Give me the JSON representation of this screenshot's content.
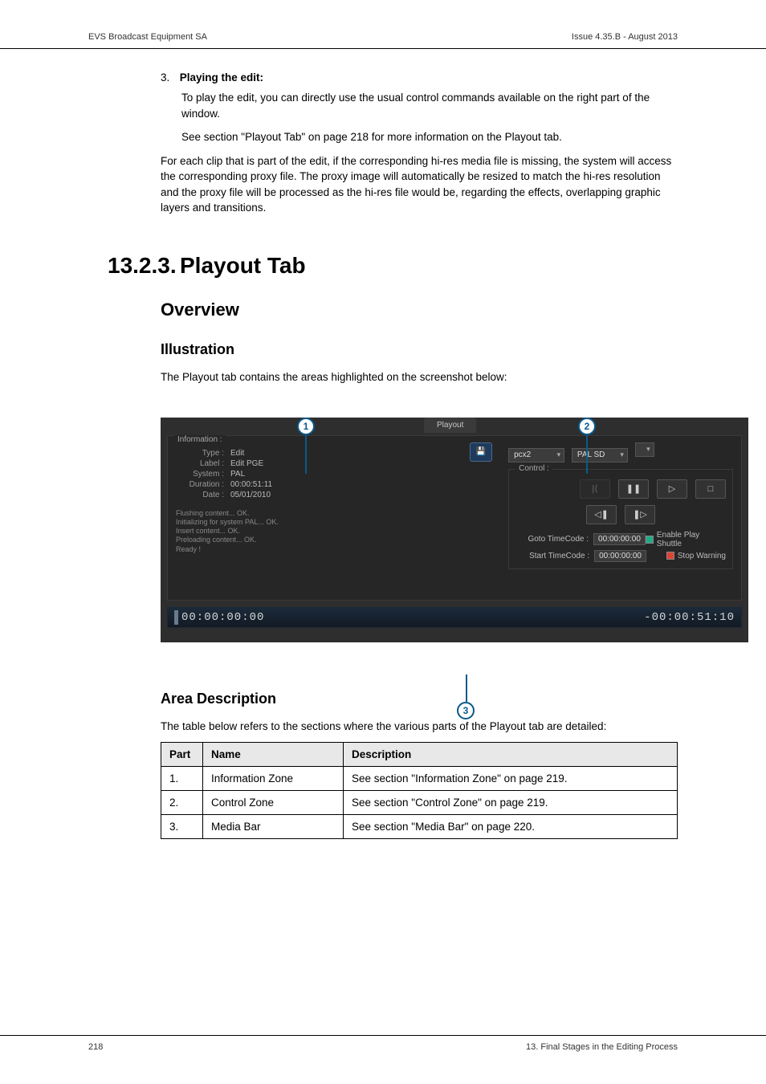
{
  "header": {
    "left": "EVS Broadcast Equipment SA",
    "right": "Issue 4.35.B - August 2013"
  },
  "body": {
    "step3_number": "3.",
    "step3_title": "Playing the edit:",
    "step3_p1": "To play the edit, you can directly use the usual control commands available on the right part of the window.",
    "step3_p2": "See section \"Playout Tab\" on page 218 for more information on the Playout tab.",
    "para_after": "For each clip that is part of the edit, if the corresponding hi-res media file is missing, the system will access the corresponding proxy file. The proxy image will automatically be resized to match the hi-res resolution and the proxy file will be processed as the hi-res file would be, regarding the effects, overlapping graphic layers and transitions.",
    "h1_num": "13.2.3.",
    "h1_text": "Playout Tab",
    "h2_overview": "Overview",
    "h3_illustration": "Illustration",
    "illus_lead": "The Playout tab contains the areas highlighted on the screenshot below:",
    "h3_area": "Area Description",
    "table_lead": "The table below refers to the sections where the various parts of the Playout tab are detailed:"
  },
  "bubbles": {
    "b1": "1",
    "b2": "2",
    "b3": "3"
  },
  "ui": {
    "tab_label": "Playout",
    "info_legend": "Information :",
    "info": {
      "type_k": "Type :",
      "type_v": "Edit",
      "label_k": "Label :",
      "label_v": "Edit PGE",
      "system_k": "System :",
      "system_v": "PAL",
      "duration_k": "Duration :",
      "duration_v": "00:00:51:11",
      "date_k": "Date :",
      "date_v": "05/01/2010"
    },
    "log": {
      "l1": "Flushing content... OK.",
      "l2": "Initializing for system PAL... OK.",
      "l3": "Insert content... OK.",
      "l4": "Preloading content... OK.",
      "l5": "Ready !"
    },
    "save_icon_glyph": "💾",
    "dd_device": "pcx2",
    "dd_format": "PAL SD",
    "ctrl_legend": "Control :",
    "transport": {
      "goto_start": "|⟨",
      "pause": "❚❚",
      "play": "▷",
      "stop": "□",
      "step_back": "◁❚",
      "step_fwd": "❚▷"
    },
    "goto_tc_label": "Goto TimeCode :",
    "goto_tc_value": "00:00:00:00",
    "start_tc_label": "Start TimeCode :",
    "start_tc_value": "00:00:00:00",
    "chk_play_shuttle": "Enable Play Shuttle",
    "chk_stop_warning": "Stop Warning",
    "media_left": "00:00:00:00",
    "media_right": "-00:00:51:10"
  },
  "table": {
    "headers": {
      "c1": "Part",
      "c2": "Name",
      "c3": "Description"
    },
    "rows": [
      {
        "c1": "1.",
        "c2": "Information Zone",
        "c3": "See section \"Information Zone\" on page 219."
      },
      {
        "c1": "2.",
        "c2": "Control Zone",
        "c3": "See section \"Control Zone\" on page 219."
      },
      {
        "c1": "3.",
        "c2": "Media Bar",
        "c3": "See section \"Media Bar\" on page 220."
      }
    ]
  },
  "footer": {
    "left": "218",
    "right": "13. Final Stages in the Editing Process"
  }
}
